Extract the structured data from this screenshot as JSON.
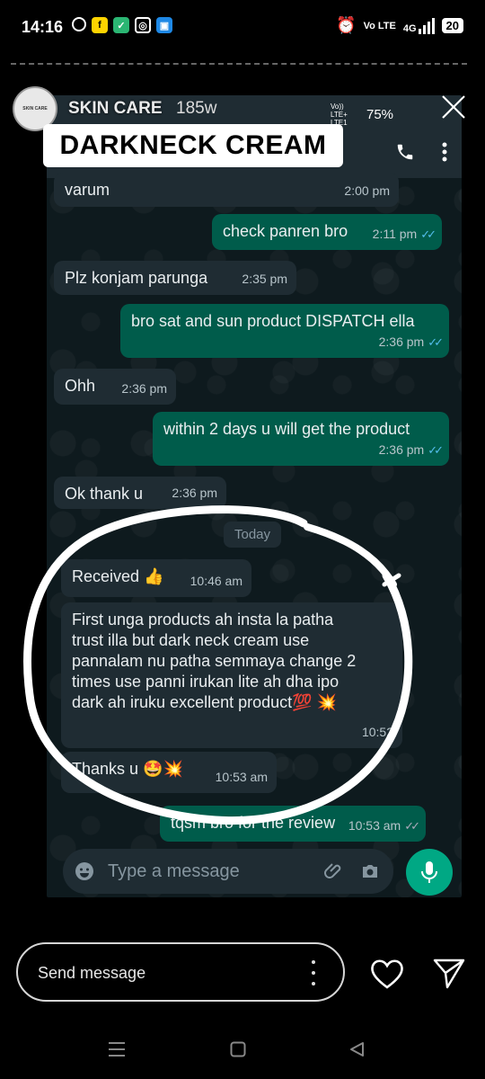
{
  "status_bar": {
    "time": "14:16",
    "network_label": "Vo LTE",
    "signal_label": "4G",
    "battery": "20"
  },
  "story": {
    "account_name": "SKIN CARE",
    "avatar_text": "SKIN CARE",
    "elapsed": "185w",
    "inner_status_network": "Vo)) LTE+ LTE1",
    "inner_battery": "75%",
    "sticker_text": "DARKNECK CREAM",
    "reply_placeholder": "Send message"
  },
  "chat": {
    "today_label": "Today",
    "composer_placeholder": "Type a message",
    "messages": [
      {
        "dir": "in",
        "text": "varum",
        "time": "2:00 pm"
      },
      {
        "dir": "out",
        "text": "check panren bro",
        "time": "2:11 pm"
      },
      {
        "dir": "in",
        "text": "Plz konjam parunga",
        "time": "2:35 pm"
      },
      {
        "dir": "out",
        "text": "bro sat and sun product DISPATCH ella",
        "time": "2:36 pm"
      },
      {
        "dir": "in",
        "text": "Ohh",
        "time": "2:36 pm"
      },
      {
        "dir": "out",
        "text": "within 2 days u will get the product",
        "time": "2:36 pm"
      },
      {
        "dir": "in",
        "text": "Ok thank u",
        "time": "2:36 pm"
      },
      {
        "dir": "in",
        "text": "Received 👍",
        "time": "10:46 am"
      },
      {
        "dir": "in",
        "text": "First unga products ah insta la patha\ntrust illa but dark neck cream use\npannalam nu patha semmaya change 2\ntimes use panni irukan lite ah dha ipo\ndark ah iruku excellent product💯 💥",
        "time": "10:52"
      },
      {
        "dir": "in",
        "text": "Thanks u 🤩💥",
        "time": "10:53 am"
      },
      {
        "dir": "out",
        "text": "tqsm bro for the review",
        "time": "10:53 am"
      }
    ]
  },
  "colors": {
    "incoming_bubble": "#1f2c33",
    "outgoing_bubble": "#005c4b",
    "accent": "#00a884",
    "read_ticks": "#53bdeb"
  }
}
